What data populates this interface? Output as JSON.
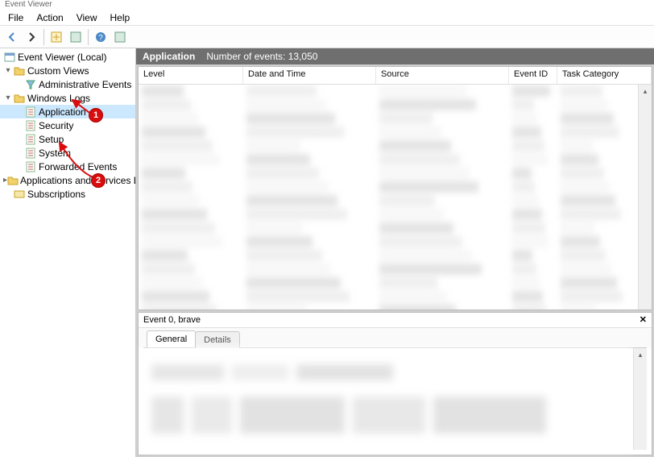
{
  "window_title": "Event Viewer",
  "menu": {
    "file": "File",
    "action": "Action",
    "view": "View",
    "help": "Help"
  },
  "tree": {
    "root": "Event Viewer (Local)",
    "custom_views": "Custom Views",
    "admin_events": "Administrative Events",
    "windows_logs": "Windows Logs",
    "application": "Application",
    "security": "Security",
    "setup": "Setup",
    "system": "System",
    "forwarded": "Forwarded Events",
    "apps_services": "Applications and Services Lo",
    "subscriptions": "Subscriptions"
  },
  "header": {
    "title": "Application",
    "count_label": "Number of events: 13,050"
  },
  "columns": {
    "level": "Level",
    "datetime": "Date and Time",
    "source": "Source",
    "eventid": "Event ID",
    "taskcat": "Task Category"
  },
  "detail": {
    "title": "Event 0, brave",
    "tab_general": "General",
    "tab_details": "Details"
  },
  "annotations": {
    "c1": "1",
    "c2": "2"
  }
}
